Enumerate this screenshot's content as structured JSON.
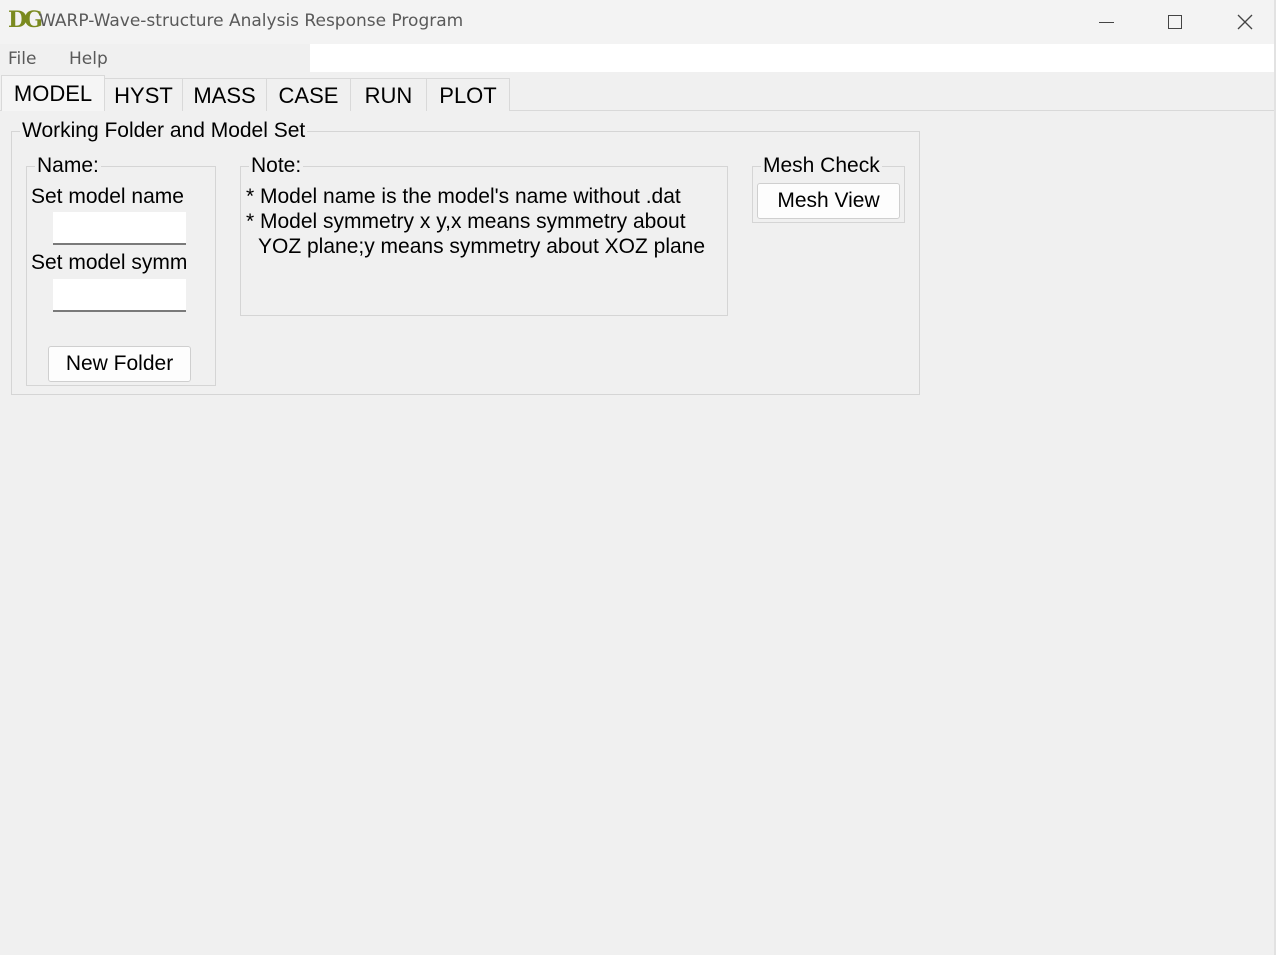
{
  "window": {
    "icon_text": "DG",
    "title": "WARP-Wave-structure Analysis Response Program"
  },
  "menubar": {
    "items": [
      "File",
      "Help"
    ]
  },
  "tabs": [
    {
      "label": "MODEL",
      "active": true
    },
    {
      "label": "HYST",
      "active": false
    },
    {
      "label": "MASS",
      "active": false
    },
    {
      "label": "CASE",
      "active": false
    },
    {
      "label": "RUN",
      "active": false
    },
    {
      "label": "PLOT",
      "active": false
    }
  ],
  "model_tab": {
    "group_title": "Working Folder and Model Set",
    "name_group": {
      "title": "Name:",
      "set_model_name_label": "Set model name",
      "model_name_value": "",
      "set_model_symm_label": "Set model symm",
      "model_symm_value": "",
      "new_folder_button": "New Folder"
    },
    "note_group": {
      "title": "Note:",
      "lines": [
        "* Model name is the model's name without .dat",
        "* Model symmetry x y,x means symmetry about",
        "YOZ plane;y means symmetry about XOZ plane"
      ]
    },
    "mesh_group": {
      "title": "Mesh Check",
      "mesh_view_button": "Mesh View"
    }
  }
}
